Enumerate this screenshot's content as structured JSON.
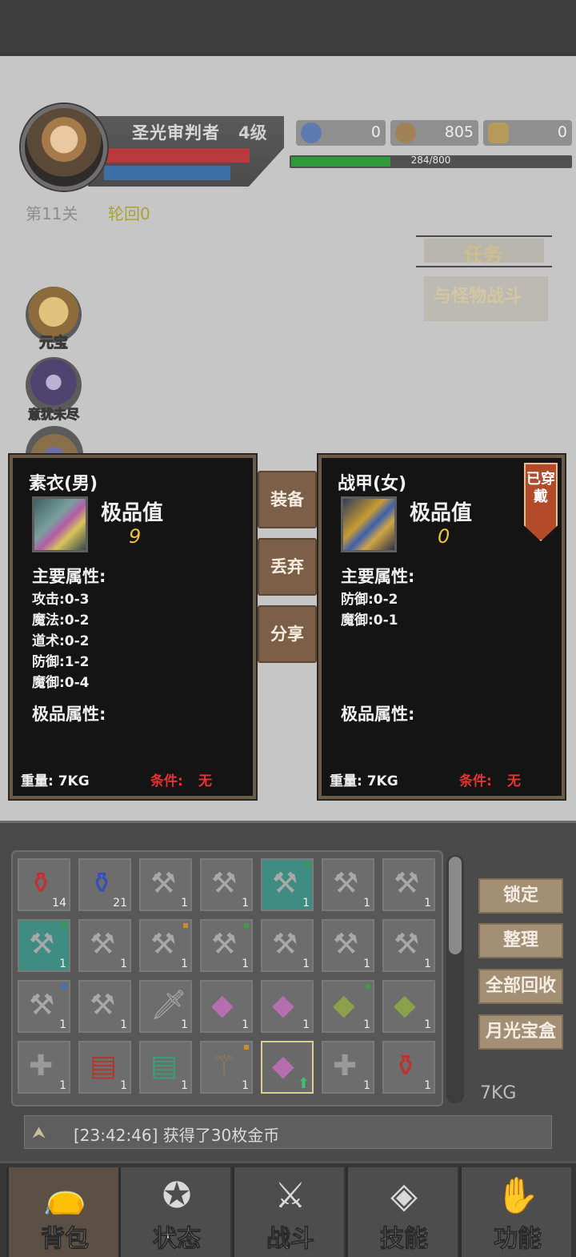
{
  "player": {
    "name": "圣光审判者",
    "level": "4级",
    "exp_text": "284/800",
    "exp_fraction": 0.355,
    "hp_fraction": 0.9,
    "mp_fraction": 0.85
  },
  "currencies": [
    {
      "icon": "compass-star-icon",
      "value": "0"
    },
    {
      "icon": "coin-pile-icon",
      "value": "805"
    },
    {
      "icon": "gold-ingot-icon",
      "value": "0"
    }
  ],
  "progress": {
    "stage": "第11关",
    "rebirth": "轮回0"
  },
  "quest": {
    "title": "任务",
    "desc": "与怪物战斗"
  },
  "side_buttons": [
    {
      "label": "元宝",
      "icon": "gold-ingot-icon",
      "color": "#b89b5a"
    },
    {
      "label": "意犹未尽",
      "icon": "crystal-orb-icon",
      "color": "#6d5a8e"
    }
  ],
  "left_item": {
    "name": "素衣(男)",
    "grade_label": "极品值",
    "grade_value": "9",
    "main_attr_title": "主要属性:",
    "stats": [
      "攻击:0-3",
      "魔法:0-2",
      "道术:0-2",
      "防御:1-2",
      "魔御:0-4"
    ],
    "extra_attr_title": "极品属性:",
    "weight": "重量: 7KG",
    "cond_label": "条件:",
    "cond_value": "无"
  },
  "right_item": {
    "name": "战甲(女)",
    "grade_label": "极品值",
    "grade_value": "0",
    "worn_tag": "已穿戴",
    "main_attr_title": "主要属性:",
    "stats": [
      "防御:0-2",
      "魔御:0-1"
    ],
    "extra_attr_title": "极品属性:",
    "weight": "重量: 7KG",
    "cond_label": "条件:",
    "cond_value": "无"
  },
  "actions": {
    "equip": "装备",
    "discard": "丢弃",
    "share": "分享"
  },
  "inventory": {
    "slots": [
      {
        "icon": "red-potion-icon",
        "count": "14"
      },
      {
        "icon": "blue-potion-icon",
        "count": "21"
      },
      {
        "icon": "hammer-icon",
        "count": "1"
      },
      {
        "icon": "hammer-icon",
        "count": "1"
      },
      {
        "icon": "hammer-icon",
        "count": "1",
        "teal": true
      },
      {
        "icon": "hammer-icon",
        "count": "1"
      },
      {
        "icon": "hammer-icon",
        "count": "1"
      },
      {
        "icon": "hammer-icon",
        "count": "1",
        "teal": true
      },
      {
        "icon": "hammer-icon",
        "count": "1"
      },
      {
        "icon": "hammer-icon",
        "count": "1"
      },
      {
        "icon": "hammer-icon",
        "count": "1"
      },
      {
        "icon": "hammer-icon",
        "count": "1"
      },
      {
        "icon": "hammer-icon",
        "count": "1"
      },
      {
        "icon": "hammer-icon",
        "count": "1"
      },
      {
        "icon": "hammer-icon",
        "count": "1"
      },
      {
        "icon": "hammer-icon",
        "count": "1"
      },
      {
        "icon": "blade-icon",
        "count": "1"
      },
      {
        "icon": "robe-icon",
        "count": "1"
      },
      {
        "icon": "robe-icon",
        "count": "1"
      },
      {
        "icon": "armor-icon",
        "count": "1"
      },
      {
        "icon": "armor-icon",
        "count": "1"
      },
      {
        "icon": "mace-icon",
        "count": "1"
      },
      {
        "icon": "red-book-icon",
        "count": "1"
      },
      {
        "icon": "green-book-icon",
        "count": "1"
      },
      {
        "icon": "staff-icon",
        "count": "1"
      },
      {
        "icon": "robe-icon",
        "count": "",
        "selected": true
      },
      {
        "icon": "mace-icon",
        "count": "1"
      },
      {
        "icon": "red-potion-icon",
        "count": "1"
      }
    ],
    "buttons": [
      "锁定",
      "整理",
      "全部回收",
      "月光宝盒"
    ],
    "weight": "7KG"
  },
  "log": {
    "text": "[23:42:46] 获得了30枚金币"
  },
  "nav": [
    {
      "label": "背包",
      "icon": "bag-icon",
      "active": true
    },
    {
      "label": "状态",
      "icon": "status-emblem-icon"
    },
    {
      "label": "战斗",
      "icon": "battle-banner-icon"
    },
    {
      "label": "技能",
      "icon": "skill-diamond-icon"
    },
    {
      "label": "功能",
      "icon": "hand-icon"
    }
  ],
  "colors": {
    "hp": "#b83a3c",
    "mp": "#3c6fa3",
    "exp": "#2f9a3a",
    "accent_gold": "#f2c230",
    "alert_red": "#e13434"
  }
}
